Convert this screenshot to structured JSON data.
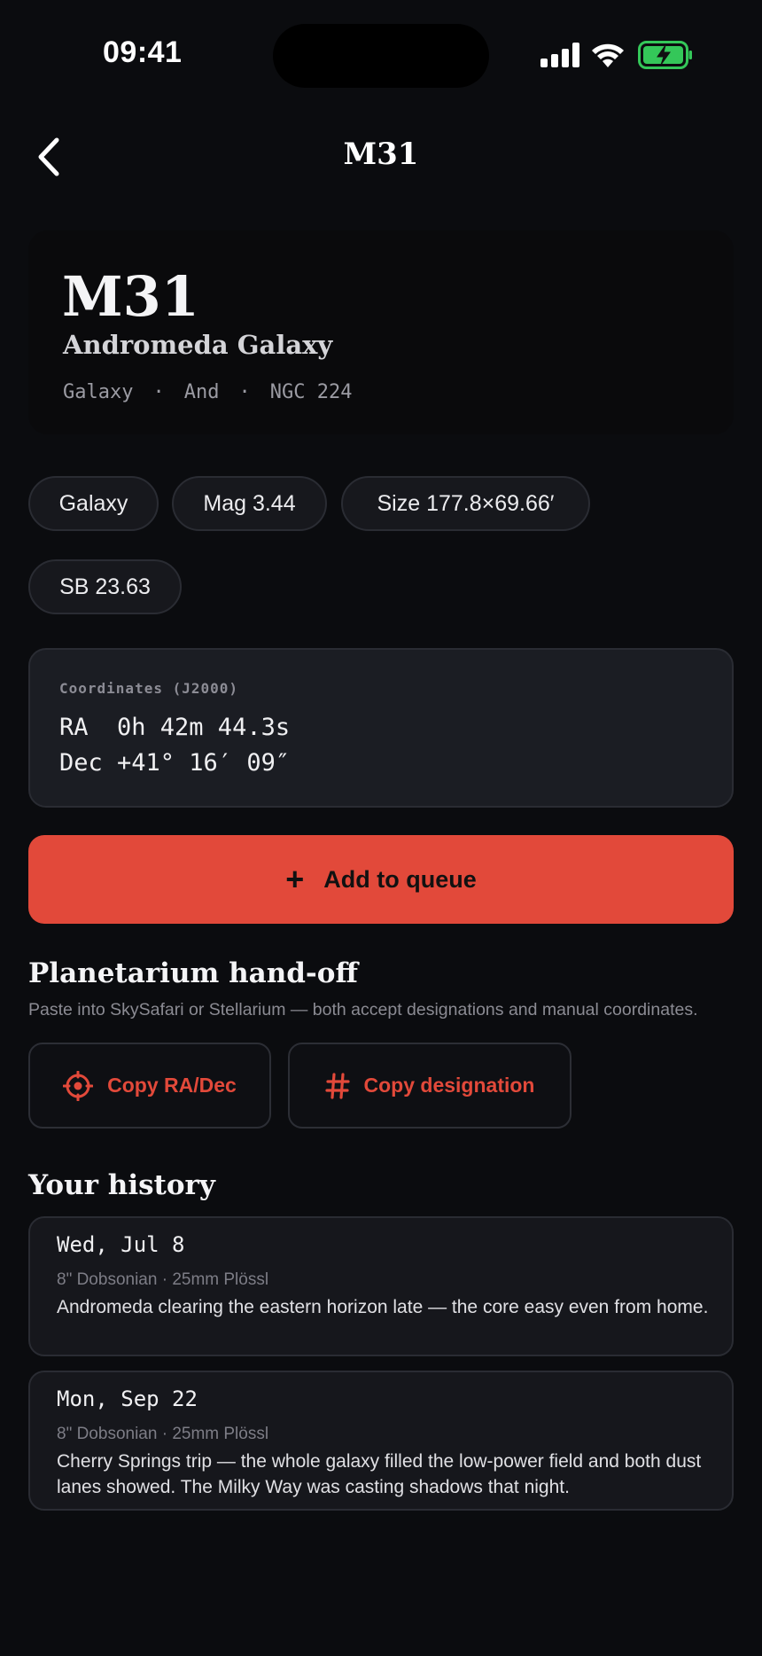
{
  "status_bar": {
    "time": "09:41"
  },
  "nav": {
    "title": "M31",
    "back_icon": "chevron-left-icon"
  },
  "object": {
    "designation": "M31",
    "name": "Andromeda Galaxy",
    "meta": [
      "Galaxy",
      "And",
      "NGC 224"
    ]
  },
  "chips": [
    "Galaxy",
    "Mag 3.44",
    "Size 177.8×69.66′",
    "SB 23.63"
  ],
  "coordinates": {
    "label": "Coordinates (J2000)",
    "ra": "RA  0h 42m 44.3s",
    "dec": "Dec +41° 16′ 09″"
  },
  "actions": {
    "add_to_queue": "Add to queue",
    "plus_symbol": "+"
  },
  "handoff": {
    "title": "Planetarium hand-off",
    "description": "Paste into SkySafari or Stellarium — both accept designations and manual coordinates.",
    "copy_radec": "Copy RA/Dec",
    "copy_designation": "Copy designation"
  },
  "history": {
    "title": "Your history",
    "entries": [
      {
        "date": "Wed, Jul 8",
        "gear": "8\" Dobsonian · 25mm Plössl",
        "note": "Andromeda clearing the eastern horizon late — the core easy even from home."
      },
      {
        "date": "Mon, Sep 22",
        "gear": "8\" Dobsonian · 25mm Plössl",
        "note": "Cherry Springs trip — the whole galaxy filled the low-power field and both dust lanes showed. The Milky Way was casting shadows that night."
      }
    ]
  },
  "colors": {
    "background": "#0b0c0f",
    "accent": "#e2493a",
    "battery_fill": "#34c759"
  }
}
